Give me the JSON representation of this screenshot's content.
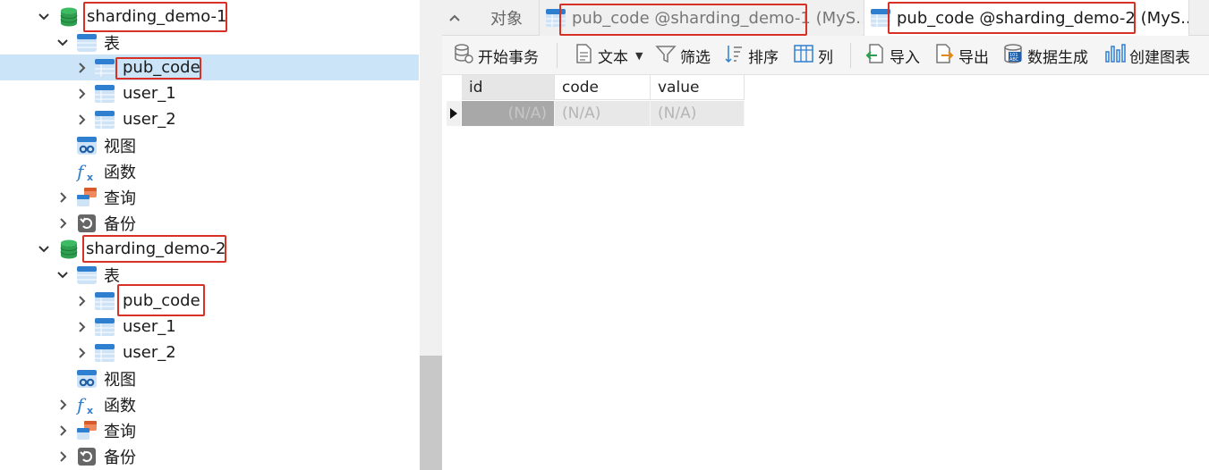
{
  "tree": {
    "db1": {
      "name": "sharding_demo-1"
    },
    "db1_tables": {
      "label": "表"
    },
    "db1_table_items": [
      "pub_code",
      "user_1",
      "user_2"
    ],
    "db1_views": {
      "label": "视图"
    },
    "db1_functions": {
      "label": "函数"
    },
    "db1_queries": {
      "label": "查询"
    },
    "db1_backups": {
      "label": "备份"
    },
    "db2": {
      "name": "sharding_demo-2"
    },
    "db2_tables": {
      "label": "表"
    },
    "db2_table_items": [
      "pub_code",
      "user_1",
      "user_2"
    ],
    "db2_views": {
      "label": "视图"
    },
    "db2_functions": {
      "label": "函数"
    },
    "db2_queries": {
      "label": "查询"
    },
    "db2_backups": {
      "label": "备份"
    }
  },
  "tabs": {
    "objects": "对象",
    "tab1": "pub_code @sharding_demo-1 (MyS...",
    "tab2": "pub_code @sharding_demo-2 (MyS..."
  },
  "toolbar": {
    "begin_transaction": "开始事务",
    "text": "文本",
    "filter": "筛选",
    "sort": "排序",
    "columns": "列",
    "import": "导入",
    "export": "导出",
    "generate_data": "数据生成",
    "create_chart": "创建图表"
  },
  "grid": {
    "columns": [
      "id",
      "code",
      "value"
    ],
    "row": [
      "(N/A)",
      "(N/A)",
      "(N/A)"
    ]
  },
  "colors": {
    "highlight_box": "#d93025",
    "selected_row": "#cce4f7",
    "db_icon": "#2e9e4f",
    "table_icon": "#2f7fd0"
  }
}
